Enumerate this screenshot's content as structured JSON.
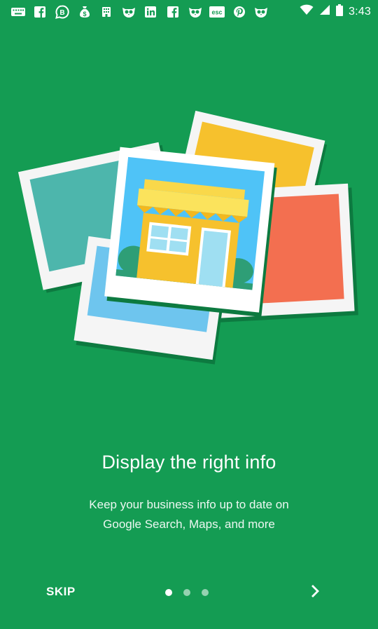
{
  "status_bar": {
    "time": "3:43",
    "notification_icons": [
      "keyboard-icon",
      "facebook-icon",
      "bbm-icon",
      "money-bag-icon",
      "building-icon",
      "owl-icon",
      "linkedin-icon",
      "facebook-icon",
      "owl-icon",
      "esc-icon",
      "pinterest-icon",
      "owl-icon"
    ],
    "esc_label": "esc"
  },
  "onboarding": {
    "title": "Display the right info",
    "subtitle_line1": "Keep your business info up to date on",
    "subtitle_line2": "Google Search, Maps, and more"
  },
  "footer": {
    "skip_label": "SKIP",
    "page_count": 3,
    "current_page": 1
  },
  "colors": {
    "background": "#149c53",
    "text": "#ffffff"
  }
}
